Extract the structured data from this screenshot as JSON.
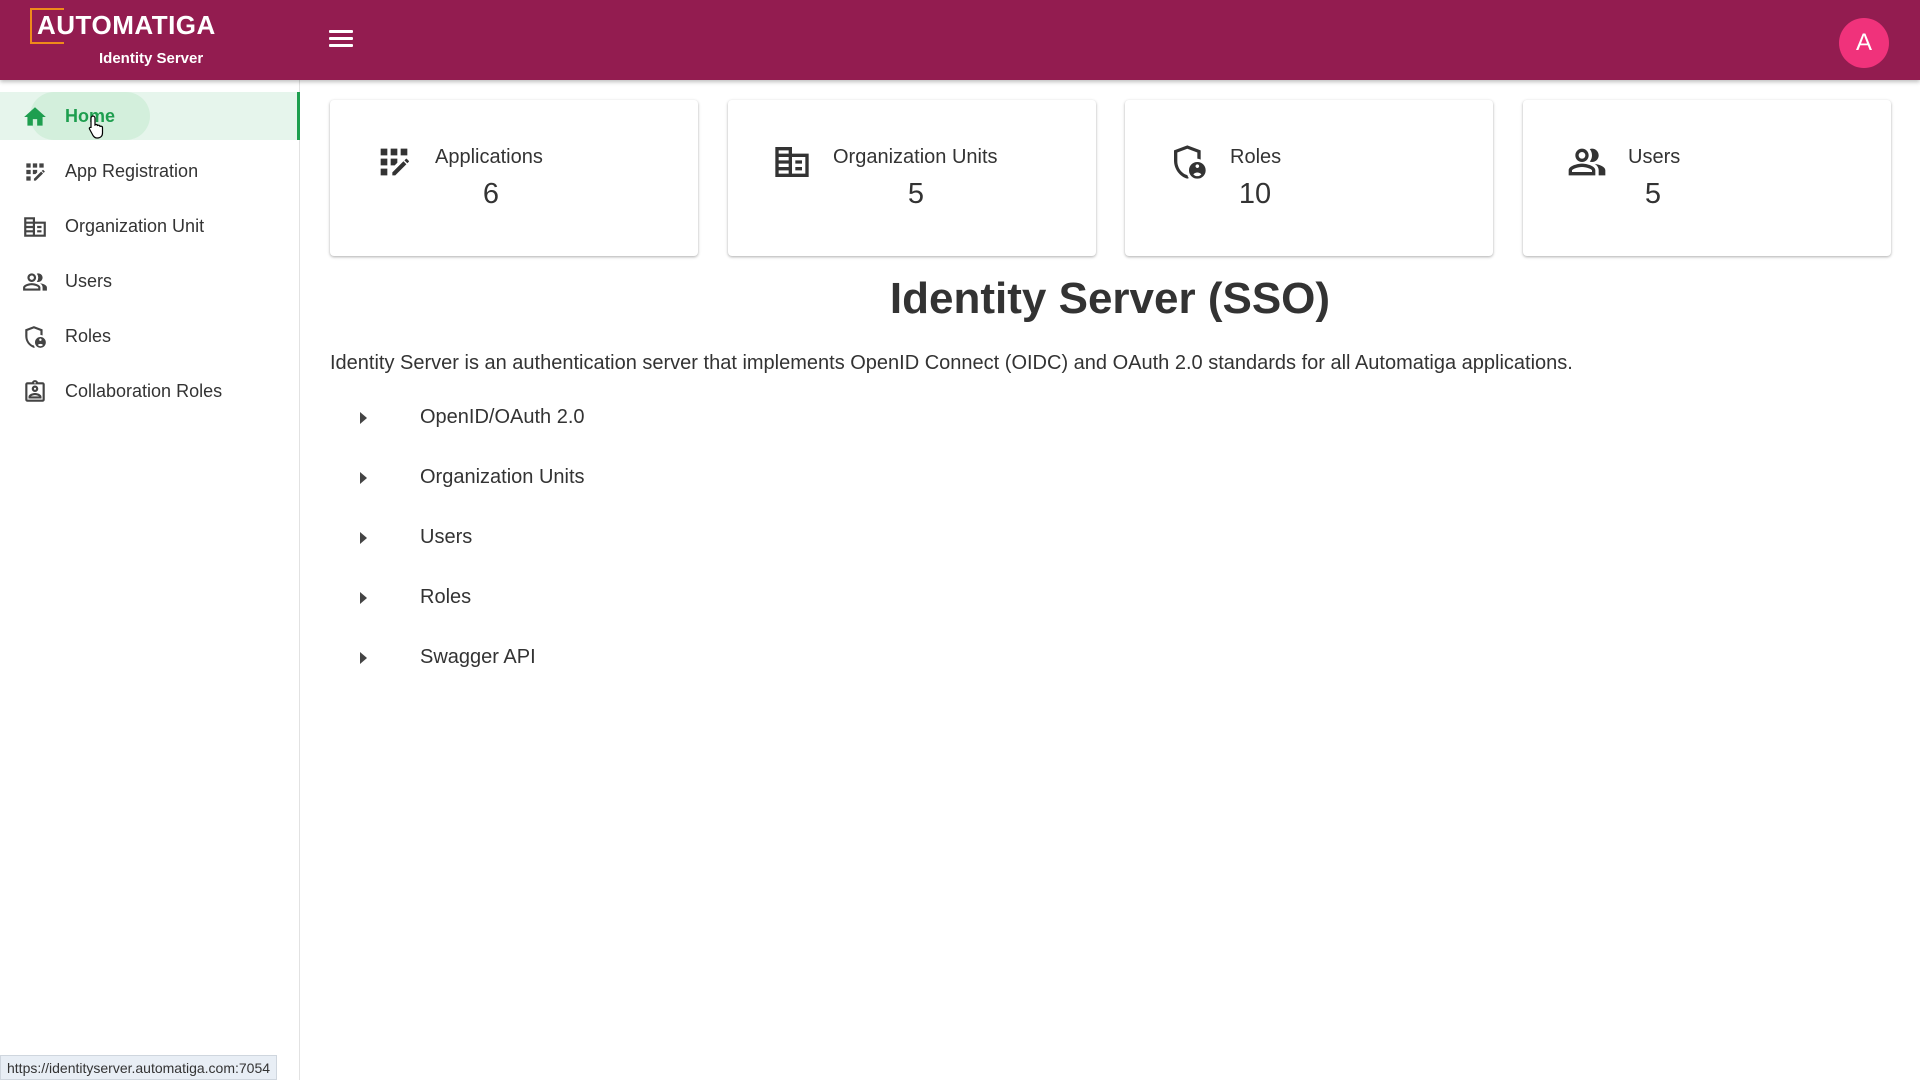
{
  "header": {
    "brand": "AUTOMATIGA",
    "subtitle": "Identity Server",
    "avatar_initial": "A",
    "brand_color": "#931c50",
    "avatar_color": "#f0327b"
  },
  "sidebar": {
    "items": [
      {
        "label": "Home",
        "icon": "home-icon",
        "active": true
      },
      {
        "label": "App Registration",
        "icon": "app-registration-icon",
        "active": false
      },
      {
        "label": "Organization Unit",
        "icon": "organization-icon",
        "active": false
      },
      {
        "label": "Users",
        "icon": "users-icon",
        "active": false
      },
      {
        "label": "Roles",
        "icon": "roles-icon",
        "active": false
      },
      {
        "label": "Collaboration Roles",
        "icon": "collaboration-roles-icon",
        "active": false
      }
    ],
    "active_color": "#1e9e4f"
  },
  "cards": [
    {
      "title": "Applications",
      "value": "6",
      "icon": "app-registration-icon"
    },
    {
      "title": "Organization Units",
      "value": "5",
      "icon": "organization-icon"
    },
    {
      "title": "Roles",
      "value": "10",
      "icon": "roles-icon"
    },
    {
      "title": "Users",
      "value": "5",
      "icon": "users-icon"
    }
  ],
  "main": {
    "title": "Identity Server (SSO)",
    "intro": "Identity Server is an authentication server that implements OpenID Connect (OIDC) and OAuth 2.0 standards for all Automatiga applications.",
    "sections": [
      {
        "label": "OpenID/OAuth 2.0"
      },
      {
        "label": "Organization Units"
      },
      {
        "label": "Users"
      },
      {
        "label": "Roles"
      },
      {
        "label": "Swagger API"
      }
    ]
  },
  "status_bar": {
    "url": "https://identityserver.automatiga.com:7054"
  }
}
